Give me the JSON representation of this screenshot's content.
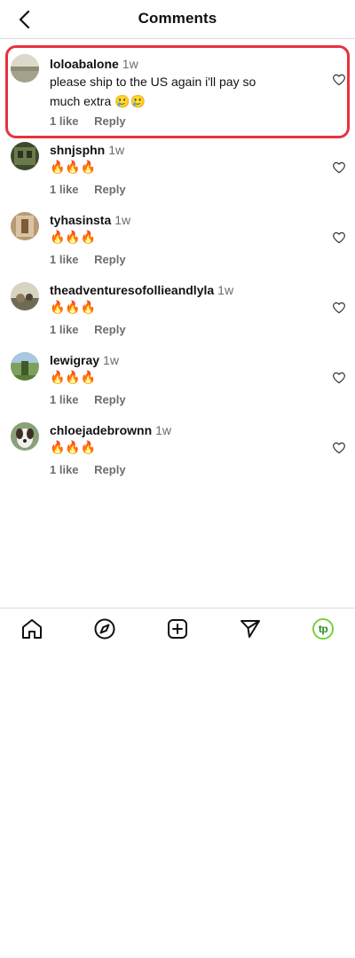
{
  "header": {
    "title": "Comments",
    "back_icon": "chevron-left-icon"
  },
  "comments": [
    {
      "username": "loloabalone",
      "time": "1w",
      "text": "please ship to the US again i'll pay so much extra 🥲🥲",
      "likes": "1 like",
      "reply": "Reply"
    },
    {
      "username": "shnjsphn",
      "time": "1w",
      "text": "🔥🔥🔥",
      "likes": "1 like",
      "reply": "Reply"
    },
    {
      "username": "tyhasinsta",
      "time": "1w",
      "text": "🔥🔥🔥",
      "likes": "1 like",
      "reply": "Reply"
    },
    {
      "username": "theadventuresofollieandlyla",
      "time": "1w",
      "text": "🔥🔥🔥",
      "likes": "1 like",
      "reply": "Reply"
    },
    {
      "username": "lewigray",
      "time": "1w",
      "text": "🔥🔥🔥",
      "likes": "1 like",
      "reply": "Reply"
    },
    {
      "username": "chloejadebrownn",
      "time": "1w",
      "text": "🔥🔥🔥",
      "likes": "1 like",
      "reply": "Reply"
    }
  ],
  "nav": {
    "items": [
      "home-icon",
      "compass-icon",
      "create-post-icon",
      "send-icon",
      "profile-avatar"
    ],
    "profile_initials": "tp",
    "profile_ring_color": "#77d13a"
  },
  "highlight_color": "#e8323f"
}
